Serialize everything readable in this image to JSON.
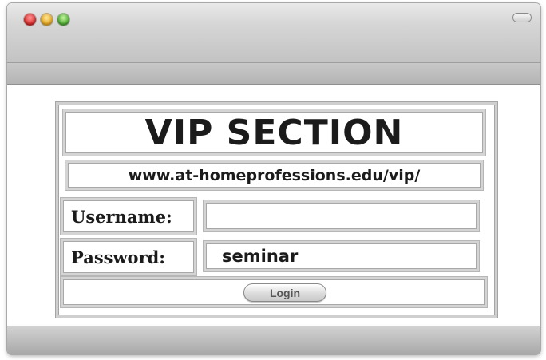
{
  "window": {
    "controls": [
      "close",
      "minimize",
      "maximize"
    ],
    "toolbar_toggle_icon": "toolbar-pill-icon"
  },
  "form": {
    "title": "VIP SECTION",
    "url": "www.at-homeprofessions.edu/vip/",
    "username": {
      "label": "Username:",
      "value": ""
    },
    "password": {
      "label": "Password:",
      "value": "seminar"
    },
    "login_label": "Login"
  },
  "colors": {
    "close": "#e0302b",
    "minimize": "#e6a71a",
    "maximize": "#47ab2c",
    "text": "#1b1b1b"
  }
}
